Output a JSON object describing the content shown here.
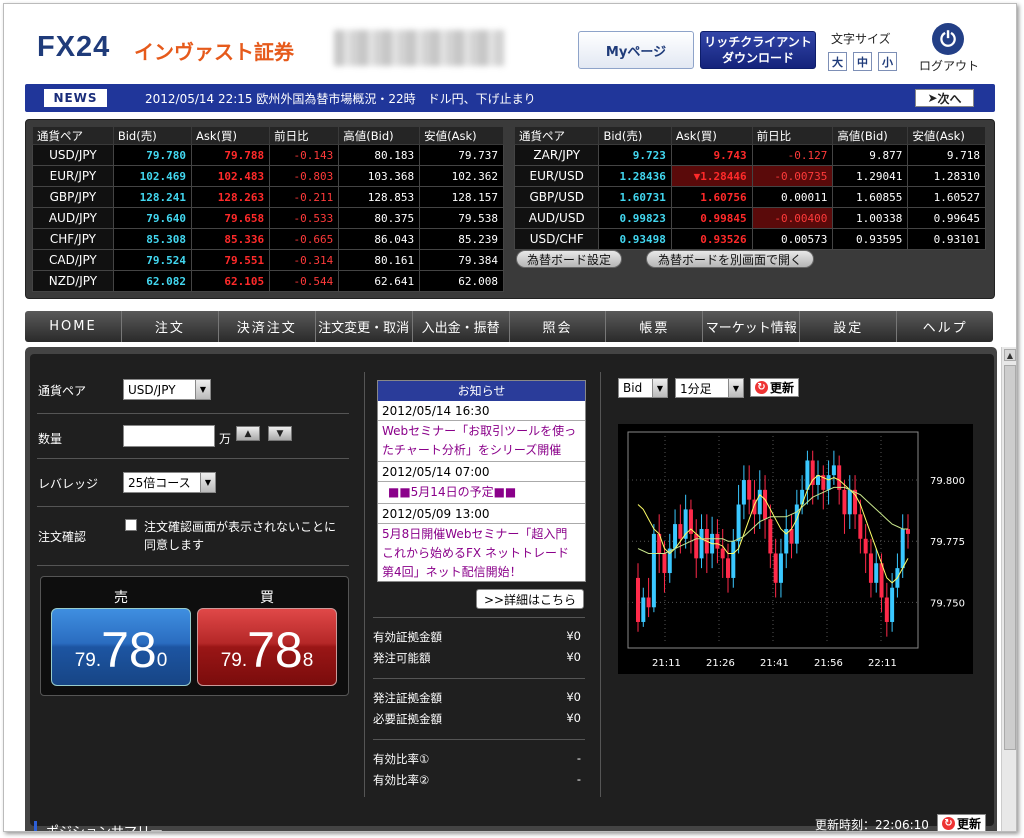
{
  "header": {
    "logo_fx": "FX24",
    "logo_company": "インヴァスト証券",
    "mypage": "Myページ",
    "rich_client_line1": "リッチクライアント",
    "rich_client_line2": "ダウンロード",
    "font_size_label": "文字サイズ",
    "font_sizes": [
      "大",
      "中",
      "小"
    ],
    "logout": "ログアウト"
  },
  "news": {
    "tag": "NEWS",
    "text": "2012/05/14 22:15 欧州外国為替市場概況・22時　ドル円、下げ止まり",
    "next": "次へ"
  },
  "rates": {
    "headers": [
      "通貨ペア",
      "Bid(売)",
      "Ask(買)",
      "前日比",
      "高値(Bid)",
      "安値(Ask)"
    ],
    "left": [
      {
        "pair": "USD/JPY",
        "bid": "79.780",
        "ask": "79.788",
        "chg": "-0.143",
        "high": "80.183",
        "low": "79.737"
      },
      {
        "pair": "EUR/JPY",
        "bid": "102.469",
        "ask": "102.483",
        "chg": "-0.803",
        "high": "103.368",
        "low": "102.362"
      },
      {
        "pair": "GBP/JPY",
        "bid": "128.241",
        "ask": "128.263",
        "chg": "-0.211",
        "high": "128.853",
        "low": "128.157"
      },
      {
        "pair": "AUD/JPY",
        "bid": "79.640",
        "ask": "79.658",
        "chg": "-0.533",
        "high": "80.375",
        "low": "79.538"
      },
      {
        "pair": "CHF/JPY",
        "bid": "85.308",
        "ask": "85.336",
        "chg": "-0.665",
        "high": "86.043",
        "low": "85.239"
      },
      {
        "pair": "CAD/JPY",
        "bid": "79.524",
        "ask": "79.551",
        "chg": "-0.314",
        "high": "80.161",
        "low": "79.384"
      },
      {
        "pair": "NZD/JPY",
        "bid": "62.082",
        "ask": "62.105",
        "chg": "-0.544",
        "high": "62.641",
        "low": "62.008"
      }
    ],
    "right": [
      {
        "pair": "ZAR/JPY",
        "bid": "9.723",
        "ask": "9.743",
        "chg": "-0.127",
        "high": "9.877",
        "low": "9.718"
      },
      {
        "pair": "EUR/USD",
        "bid": "1.28436",
        "ask": "▼1.28446",
        "chg": "-0.00735",
        "high": "1.29041",
        "low": "1.28310"
      },
      {
        "pair": "GBP/USD",
        "bid": "1.60731",
        "ask": "1.60756",
        "chg": "0.00011",
        "high": "1.60855",
        "low": "1.60527"
      },
      {
        "pair": "AUD/USD",
        "bid": "0.99823",
        "ask": "0.99845",
        "chg": "-0.00400",
        "high": "1.00338",
        "low": "0.99645"
      },
      {
        "pair": "USD/CHF",
        "bid": "0.93498",
        "ask": "0.93526",
        "chg": "0.00573",
        "high": "0.93595",
        "low": "0.93101"
      }
    ],
    "board_settings": "為替ボード設定",
    "open_separate": "為替ボードを別画面で開く"
  },
  "menu": [
    "HOME",
    "注文",
    "決済注文",
    "注文変更・取消",
    "入出金・振替",
    "照会",
    "帳票",
    "マーケット情報",
    "設定",
    "ヘルプ"
  ],
  "order": {
    "pair_label": "通貨ペア",
    "pair_value": "USD/JPY",
    "qty_label": "数量",
    "qty_value": "",
    "qty_unit": "万",
    "leverage_label": "レバレッジ",
    "leverage_value": "25倍コース",
    "confirm_label": "注文確認",
    "confirm_text": "注文確認画面が表示されないことに同意します",
    "sell_label": "売",
    "buy_label": "買",
    "sell_prefix": "79.",
    "sell_big": "78",
    "sell_suffix": "0",
    "buy_prefix": "79.",
    "buy_big": "78",
    "buy_suffix": "8"
  },
  "notice": {
    "title": "お知らせ",
    "items": [
      {
        "date": "2012/05/14 16:30",
        "text": "Webセミナー「お取引ツールを使ったチャート分析」をシリーズ開催"
      },
      {
        "date": "2012/05/14 07:00",
        "text": "■■5月14日の予定■■"
      },
      {
        "date": "2012/05/09 13:00",
        "text": "5月8日開催Webセミナー「超入門 これから始めるFX ネットトレード 第4回」ネット配信開始！"
      }
    ],
    "more": ">>詳細はこちら"
  },
  "margin": {
    "rows1": [
      {
        "label": "有効証拠金額",
        "value": "¥0"
      },
      {
        "label": "発注可能額",
        "value": "¥0"
      }
    ],
    "rows2": [
      {
        "label": "発注証拠金額",
        "value": "¥0"
      },
      {
        "label": "必要証拠金額",
        "value": "¥0"
      }
    ],
    "rows3": [
      {
        "label": "有効比率①",
        "value": "-"
      },
      {
        "label": "有効比率②",
        "value": "-"
      }
    ]
  },
  "chart": {
    "price_type": "Bid",
    "timeframe": "1分足",
    "refresh": "更新",
    "y_labels": [
      "79.800",
      "79.775",
      "79.750"
    ],
    "x_labels": [
      "21:11",
      "21:26",
      "21:41",
      "21:56",
      "22:11"
    ]
  },
  "chart_data": {
    "type": "candlestick",
    "y_ticks": [
      79.8,
      79.775,
      79.75
    ],
    "x_ticks": [
      "21:11",
      "21:26",
      "21:41",
      "21:56",
      "22:11"
    ],
    "ma_fast_color": "#ffff66",
    "ma_slow_color": "#c8e68c",
    "up_color": "#3ac8ff",
    "down_color": "#ff2a4a",
    "candles": [
      [
        79.76,
        79.742,
        79.766,
        79.738
      ],
      [
        79.742,
        79.752,
        79.756,
        79.74
      ],
      [
        79.752,
        79.748,
        79.76,
        79.744
      ],
      [
        79.748,
        79.778,
        79.782,
        79.746
      ],
      [
        79.778,
        79.77,
        79.786,
        79.762
      ],
      [
        79.77,
        79.762,
        79.775,
        79.754
      ],
      [
        79.762,
        79.772,
        79.778,
        79.758
      ],
      [
        79.772,
        79.782,
        79.788,
        79.768
      ],
      [
        79.782,
        79.776,
        79.79,
        79.77
      ],
      [
        79.776,
        79.788,
        79.794,
        79.772
      ],
      [
        79.788,
        79.778,
        79.792,
        79.77
      ],
      [
        79.778,
        79.768,
        79.784,
        79.76
      ],
      [
        79.768,
        79.78,
        79.786,
        79.764
      ],
      [
        79.78,
        79.77,
        79.786,
        79.762
      ],
      [
        79.77,
        79.778,
        79.785,
        79.764
      ],
      [
        79.778,
        79.772,
        79.784,
        79.766
      ],
      [
        79.772,
        79.768,
        79.78,
        79.76
      ],
      [
        79.768,
        79.76,
        79.774,
        79.754
      ],
      [
        79.76,
        79.775,
        79.78,
        79.756
      ],
      [
        79.775,
        79.79,
        79.798,
        79.77
      ],
      [
        79.79,
        79.8,
        79.806,
        79.784
      ],
      [
        79.8,
        79.792,
        79.806,
        79.786
      ],
      [
        79.792,
        79.786,
        79.8,
        79.778
      ],
      [
        79.786,
        79.796,
        79.804,
        79.78
      ],
      [
        79.796,
        79.784,
        79.802,
        79.776
      ],
      [
        79.784,
        79.77,
        79.79,
        79.764
      ],
      [
        79.77,
        79.758,
        79.776,
        79.752
      ],
      [
        79.758,
        79.77,
        79.776,
        79.752
      ],
      [
        79.77,
        79.78,
        79.788,
        79.764
      ],
      [
        79.78,
        79.774,
        79.786,
        79.768
      ],
      [
        79.774,
        79.79,
        79.796,
        79.77
      ],
      [
        79.79,
        79.796,
        79.802,
        79.786
      ],
      [
        79.796,
        79.808,
        79.812,
        79.79
      ],
      [
        79.808,
        79.798,
        79.812,
        79.79
      ],
      [
        79.798,
        79.802,
        79.808,
        79.792
      ],
      [
        79.802,
        79.796,
        79.806,
        79.788
      ],
      [
        79.796,
        79.802,
        79.808,
        79.79
      ],
      [
        79.802,
        79.806,
        79.812,
        79.798
      ],
      [
        79.806,
        79.796,
        79.81,
        79.79
      ],
      [
        79.796,
        79.786,
        79.8,
        79.778
      ],
      [
        79.786,
        79.796,
        79.802,
        79.78
      ],
      [
        79.796,
        79.786,
        79.802,
        79.78
      ],
      [
        79.786,
        79.776,
        79.792,
        79.77
      ],
      [
        79.776,
        79.77,
        79.782,
        79.762
      ],
      [
        79.77,
        79.758,
        79.776,
        79.752
      ],
      [
        79.758,
        79.766,
        79.772,
        79.754
      ],
      [
        79.766,
        79.752,
        79.77,
        79.746
      ],
      [
        79.752,
        79.742,
        79.758,
        79.736
      ],
      [
        79.742,
        79.756,
        79.762,
        79.738
      ],
      [
        79.756,
        79.764,
        79.77,
        79.752
      ],
      [
        79.764,
        79.78,
        79.786,
        79.76
      ],
      [
        79.78,
        79.778,
        79.786,
        79.772
      ]
    ],
    "ma_fast": [
      79.79,
      79.788,
      79.784,
      79.78,
      79.778,
      79.772,
      79.77,
      79.772,
      79.775,
      79.778,
      79.78,
      79.778,
      79.776,
      79.775,
      79.774,
      79.774,
      79.773,
      79.77,
      79.77,
      79.772,
      79.778,
      79.784,
      79.79,
      79.794,
      79.792,
      79.788,
      79.784,
      79.78,
      79.778,
      79.78,
      79.784,
      79.79,
      79.796,
      79.8,
      79.802,
      79.801,
      79.8,
      79.801,
      79.8,
      79.798,
      79.796,
      79.794,
      79.79,
      79.784,
      79.778,
      79.772,
      79.766,
      79.76,
      79.758,
      79.76,
      79.764,
      79.768
    ],
    "ma_slow": [
      79.772,
      79.771,
      79.77,
      79.77,
      79.77,
      79.77,
      79.771,
      79.772,
      79.773,
      79.774,
      79.775,
      79.776,
      79.776,
      79.776,
      79.776,
      79.776,
      79.776,
      79.775,
      79.775,
      79.776,
      79.777,
      79.779,
      79.781,
      79.783,
      79.784,
      79.785,
      79.785,
      79.785,
      79.785,
      79.786,
      79.787,
      79.789,
      79.791,
      79.793,
      79.794,
      79.795,
      79.796,
      79.797,
      79.797,
      79.797,
      79.796,
      79.795,
      79.794,
      79.792,
      79.79,
      79.788,
      79.786,
      79.784,
      79.782,
      79.781,
      79.78,
      79.78
    ]
  },
  "footer": {
    "position_summary": "ポジションサマリー",
    "update_time": "更新時刻：22:06:10",
    "refresh": "更新"
  }
}
